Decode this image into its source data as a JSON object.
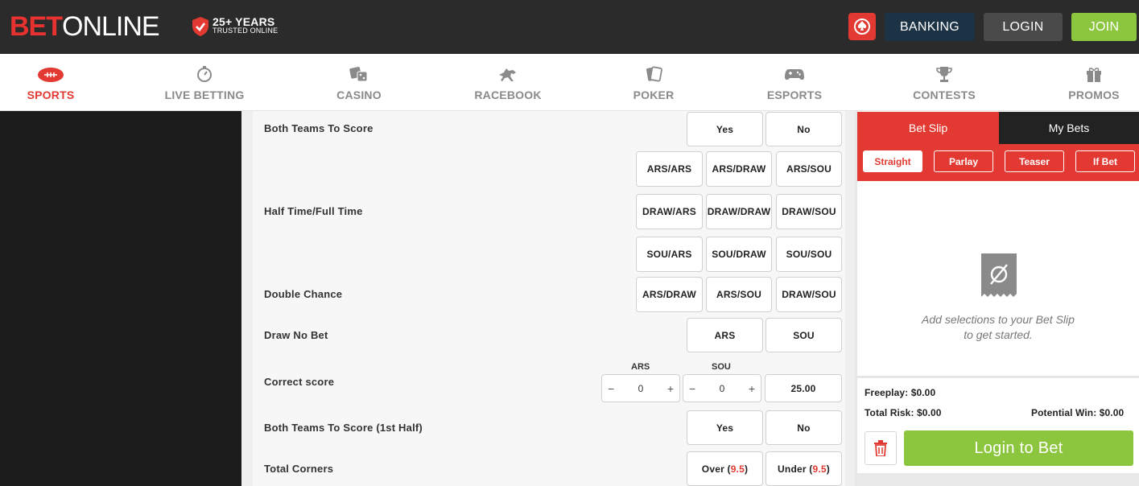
{
  "header": {
    "logo_bet": "BET",
    "logo_online": "ONLINE",
    "trust_big": "25+ YEARS",
    "trust_small": "TRUSTED ONLINE",
    "banking": "BANKING",
    "login": "LOGIN",
    "join": "JOIN"
  },
  "nav": [
    {
      "label": "SPORTS",
      "icon": "football-icon"
    },
    {
      "label": "LIVE BETTING",
      "icon": "stopwatch-icon"
    },
    {
      "label": "CASINO",
      "icon": "dice-icon"
    },
    {
      "label": "RACEBOOK",
      "icon": "horse-icon"
    },
    {
      "label": "POKER",
      "icon": "cards-icon"
    },
    {
      "label": "ESPORTS",
      "icon": "gamepad-icon"
    },
    {
      "label": "CONTESTS",
      "icon": "trophy-icon"
    },
    {
      "label": "PROMOS",
      "icon": "gift-icon"
    }
  ],
  "markets": {
    "btts": {
      "label": "Both Teams To Score",
      "yes": "Yes",
      "no": "No"
    },
    "htft": {
      "label": "Half Time/Full Time",
      "options": [
        "ARS/ARS",
        "ARS/DRAW",
        "ARS/SOU",
        "DRAW/ARS",
        "DRAW/DRAW",
        "DRAW/SOU",
        "SOU/ARS",
        "SOU/DRAW",
        "SOU/SOU"
      ]
    },
    "double_chance": {
      "label": "Double Chance",
      "options": [
        "ARS/DRAW",
        "ARS/SOU",
        "DRAW/SOU"
      ]
    },
    "draw_no_bet": {
      "label": "Draw No Bet",
      "options": [
        "ARS",
        "SOU"
      ]
    },
    "correct_score": {
      "label": "Correct score",
      "home": "ARS",
      "away": "SOU",
      "home_value": "0",
      "away_value": "0",
      "odds": "25.00",
      "minus": "−",
      "plus": "+"
    },
    "btts_1h": {
      "label": "Both Teams To Score (1st Half)",
      "yes": "Yes",
      "no": "No"
    },
    "total_corners": {
      "label": "Total Corners",
      "over": "Over (",
      "under": "Under (",
      "line": "9.5",
      "close": ")"
    }
  },
  "betslip": {
    "tab_active": "Bet Slip",
    "tab_other": "My Bets",
    "types": [
      "Straight",
      "Parlay",
      "Teaser",
      "If Bet"
    ],
    "empty_line1": "Add selections to your Bet Slip",
    "empty_line2": "to get started.",
    "freeplay": "Freeplay: $0.00",
    "total_risk": "Total Risk: $0.00",
    "potential_win": "Potential Win: $0.00",
    "login_to_bet": "Login to Bet"
  },
  "colors": {
    "accent": "#e23a33",
    "join": "#8cc63f",
    "banking": "#1c3346",
    "header": "#2b2b2b"
  }
}
